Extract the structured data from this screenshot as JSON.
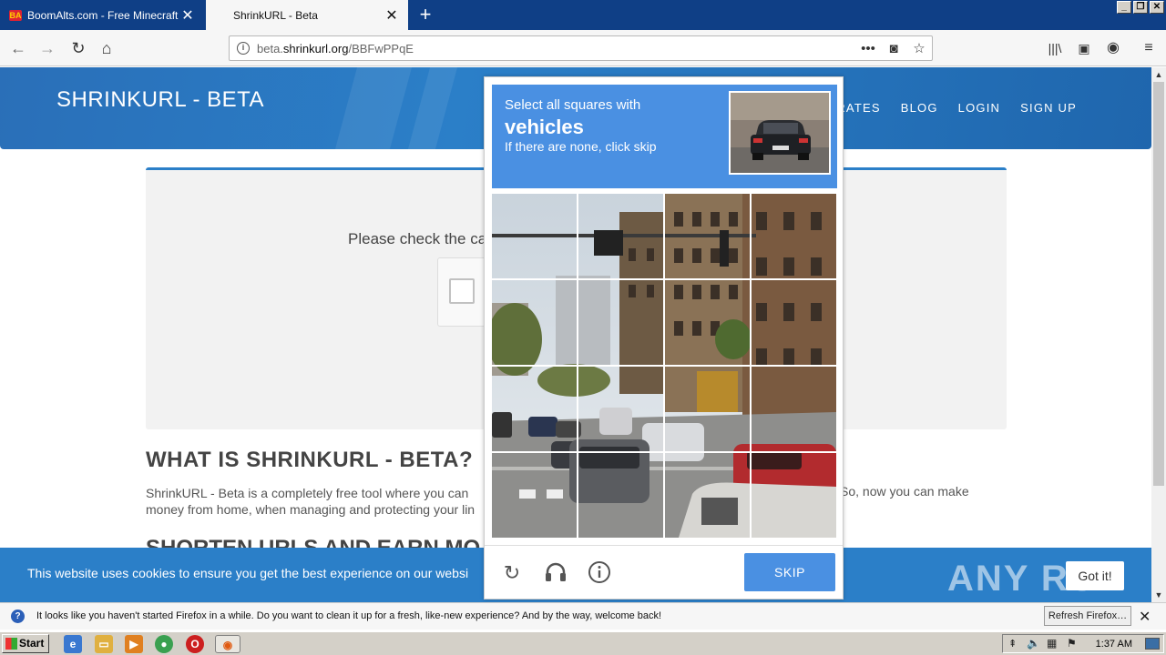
{
  "browser": {
    "tabs": [
      {
        "title": "BoomAlts.com - Free Minecraft Ac",
        "favicon_text": "BA",
        "active": false
      },
      {
        "title": "ShrinkURL - Beta",
        "active": true
      }
    ],
    "url_prefix": "beta.",
    "url_domain": "shrinkurl.org",
    "url_path": "/BBFwPPqE"
  },
  "site": {
    "brand": "SHRINKURL - BETA",
    "menu": [
      "RATES",
      "BLOG",
      "LOGIN",
      "SIGN UP"
    ],
    "check_prompt": "Please check the ca",
    "what_heading": "WHAT IS SHRINKURL - BETA?",
    "what_line1": "ShrinkURL - Beta is a completely free tool where you can",
    "what_line1_tail": "So, now you can make",
    "what_line2": "money from home, when managing and protecting your lin",
    "shorten_heading": "SHORTEN URLS AND EARN MO",
    "cookie_msg": "This website uses cookies to ensure you get the best experience on our websi",
    "got_it": "Got it!"
  },
  "captcha": {
    "line1": "Select all squares with",
    "keyword": "vehicles",
    "line3": "If there are none, click skip",
    "skip": "SKIP"
  },
  "notification": {
    "message": "It looks like you haven't started Firefox in a while. Do you want to clean it up for a fresh, like-new experience? And by the way, welcome back!",
    "button": "Refresh Firefox…"
  },
  "taskbar": {
    "start": "Start",
    "clock": "1:37 AM"
  },
  "watermark": "ANY RUN"
}
